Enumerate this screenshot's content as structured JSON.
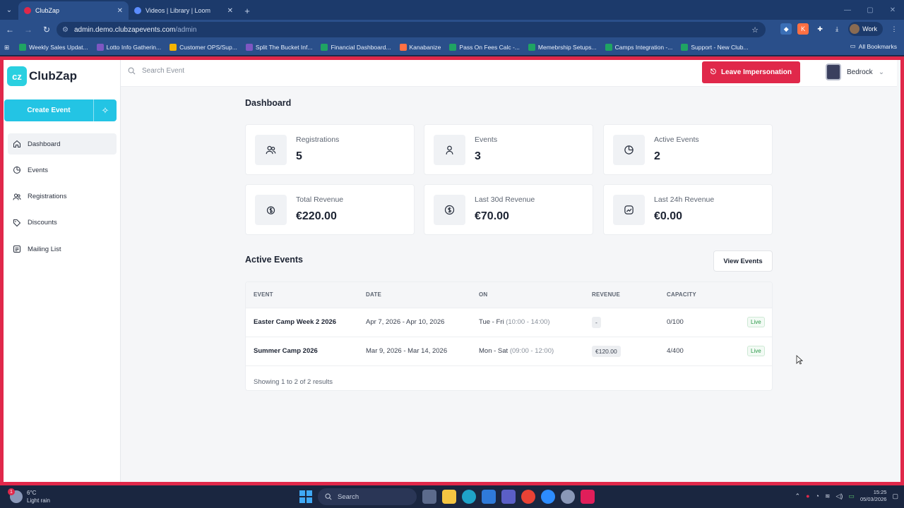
{
  "browser": {
    "tabs": [
      {
        "title": "ClubZap",
        "active": true
      },
      {
        "title": "Videos | Library | Loom",
        "active": false
      }
    ],
    "new_tab": "+",
    "url_host": "admin.demo.clubzapevents.com",
    "url_path": "/admin",
    "profile": "Work",
    "bookmarks": [
      {
        "label": "Weekly Sales Updat...",
        "color": "#1fa463"
      },
      {
        "label": "Lotto Info Gatherin...",
        "color": "#7e57c2"
      },
      {
        "label": "Customer OPS/Sup...",
        "color": "#f4b400"
      },
      {
        "label": "Split The Bucket Inf...",
        "color": "#7e57c2"
      },
      {
        "label": "Financial Dashboard...",
        "color": "#1fa463"
      },
      {
        "label": "Kanabanize",
        "color": "#ff7043"
      },
      {
        "label": "Pass On Fees Calc -...",
        "color": "#1fa463"
      },
      {
        "label": "Memebrship Setups...",
        "color": "#1fa463"
      },
      {
        "label": "Camps Integration -...",
        "color": "#1fa463"
      },
      {
        "label": "Support - New Club...",
        "color": "#1fa463"
      }
    ],
    "all_bookmarks": "All Bookmarks"
  },
  "app": {
    "logo_text": "ClubZap",
    "logo_mark": "cz",
    "create_event": "Create Event",
    "nav": [
      {
        "label": "Dashboard",
        "icon": "home-icon",
        "active": true
      },
      {
        "label": "Events",
        "icon": "events-icon",
        "active": false
      },
      {
        "label": "Registrations",
        "icon": "users-icon",
        "active": false
      },
      {
        "label": "Discounts",
        "icon": "tag-icon",
        "active": false
      },
      {
        "label": "Mailing List",
        "icon": "list-icon",
        "active": false
      }
    ],
    "search_placeholder": "Search Event",
    "leave_impersonation": "Leave Impersonation",
    "org_name": "Bedrock",
    "accent": "#23c4e4",
    "danger": "#e0284a"
  },
  "dashboard": {
    "title": "Dashboard",
    "stats": [
      {
        "label": "Registrations",
        "value": "5",
        "icon": "users-icon"
      },
      {
        "label": "Events",
        "value": "3",
        "icon": "user-icon"
      },
      {
        "label": "Active Events",
        "value": "2",
        "icon": "pie-icon"
      },
      {
        "label": "Total Revenue",
        "value": "€220.00",
        "icon": "revenue-icon"
      },
      {
        "label": "Last 30d Revenue",
        "value": "€70.00",
        "icon": "dollar-icon"
      },
      {
        "label": "Last 24h Revenue",
        "value": "€0.00",
        "icon": "trend-icon"
      }
    ],
    "active_events_title": "Active Events",
    "view_events": "View Events",
    "columns": [
      "EVENT",
      "DATE",
      "ON",
      "REVENUE",
      "CAPACITY"
    ],
    "rows": [
      {
        "event": "Easter Camp Week 2 2026",
        "date": "Apr 7, 2026 - Apr 10, 2026",
        "days": "Tue - Fri",
        "times": "(10:00 - 14:00)",
        "revenue": "-",
        "capacity": "0/100",
        "status": "Live"
      },
      {
        "event": "Summer Camp 2026",
        "date": "Mar 9, 2026 - Mar 14, 2026",
        "days": "Mon - Sat",
        "times": "(09:00 - 12:00)",
        "revenue": "€120.00",
        "capacity": "4/400",
        "status": "Live"
      }
    ],
    "footer": "Showing 1 to 2 of 2 results"
  },
  "taskbar": {
    "temp": "6°C",
    "weather": "Light rain",
    "notif": "1",
    "search": "Search",
    "time": "15:25",
    "date": "05/03/2026"
  }
}
